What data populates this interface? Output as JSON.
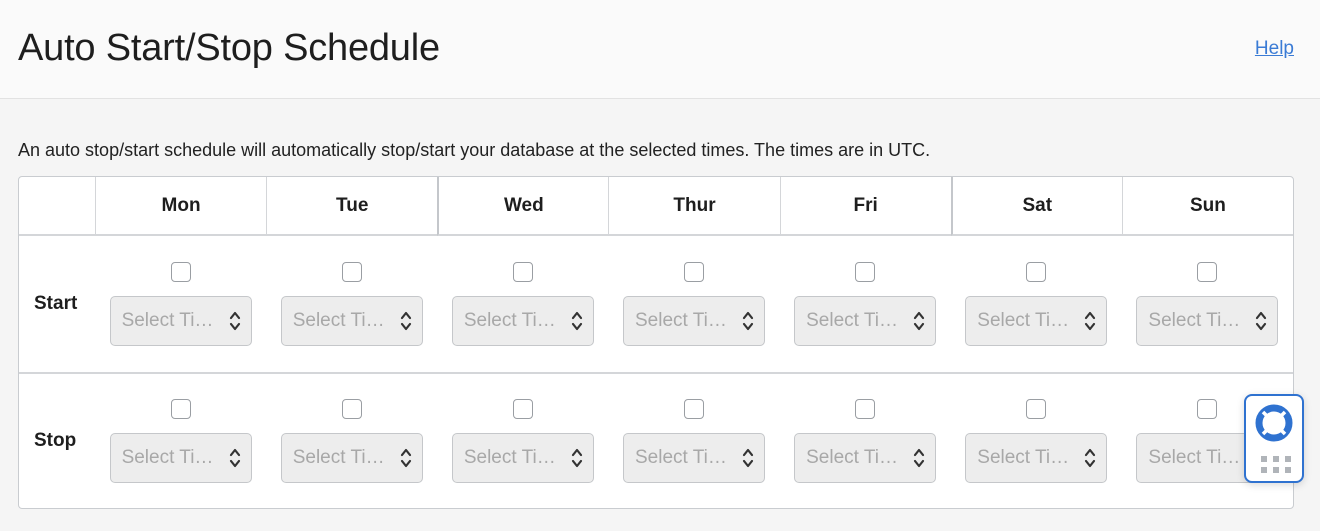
{
  "header": {
    "title": "Auto Start/Stop Schedule",
    "help_label": "Help"
  },
  "description": "An auto stop/start schedule will automatically stop/start your database at the selected times. The times are in UTC.",
  "table": {
    "days": [
      "Mon",
      "Tue",
      "Wed",
      "Thur",
      "Fri",
      "Sat",
      "Sun"
    ],
    "rows": [
      {
        "label": "Start",
        "placeholder": "Select Ti…"
      },
      {
        "label": "Stop",
        "placeholder": "Select Ti…"
      }
    ],
    "select_placeholder": "Select Ti…"
  },
  "help_widget": {
    "icon": "lifebuoy-icon",
    "accent": "#2f72d0"
  },
  "colors": {
    "link": "#3a7bd5",
    "background": "#f5f5f5"
  }
}
